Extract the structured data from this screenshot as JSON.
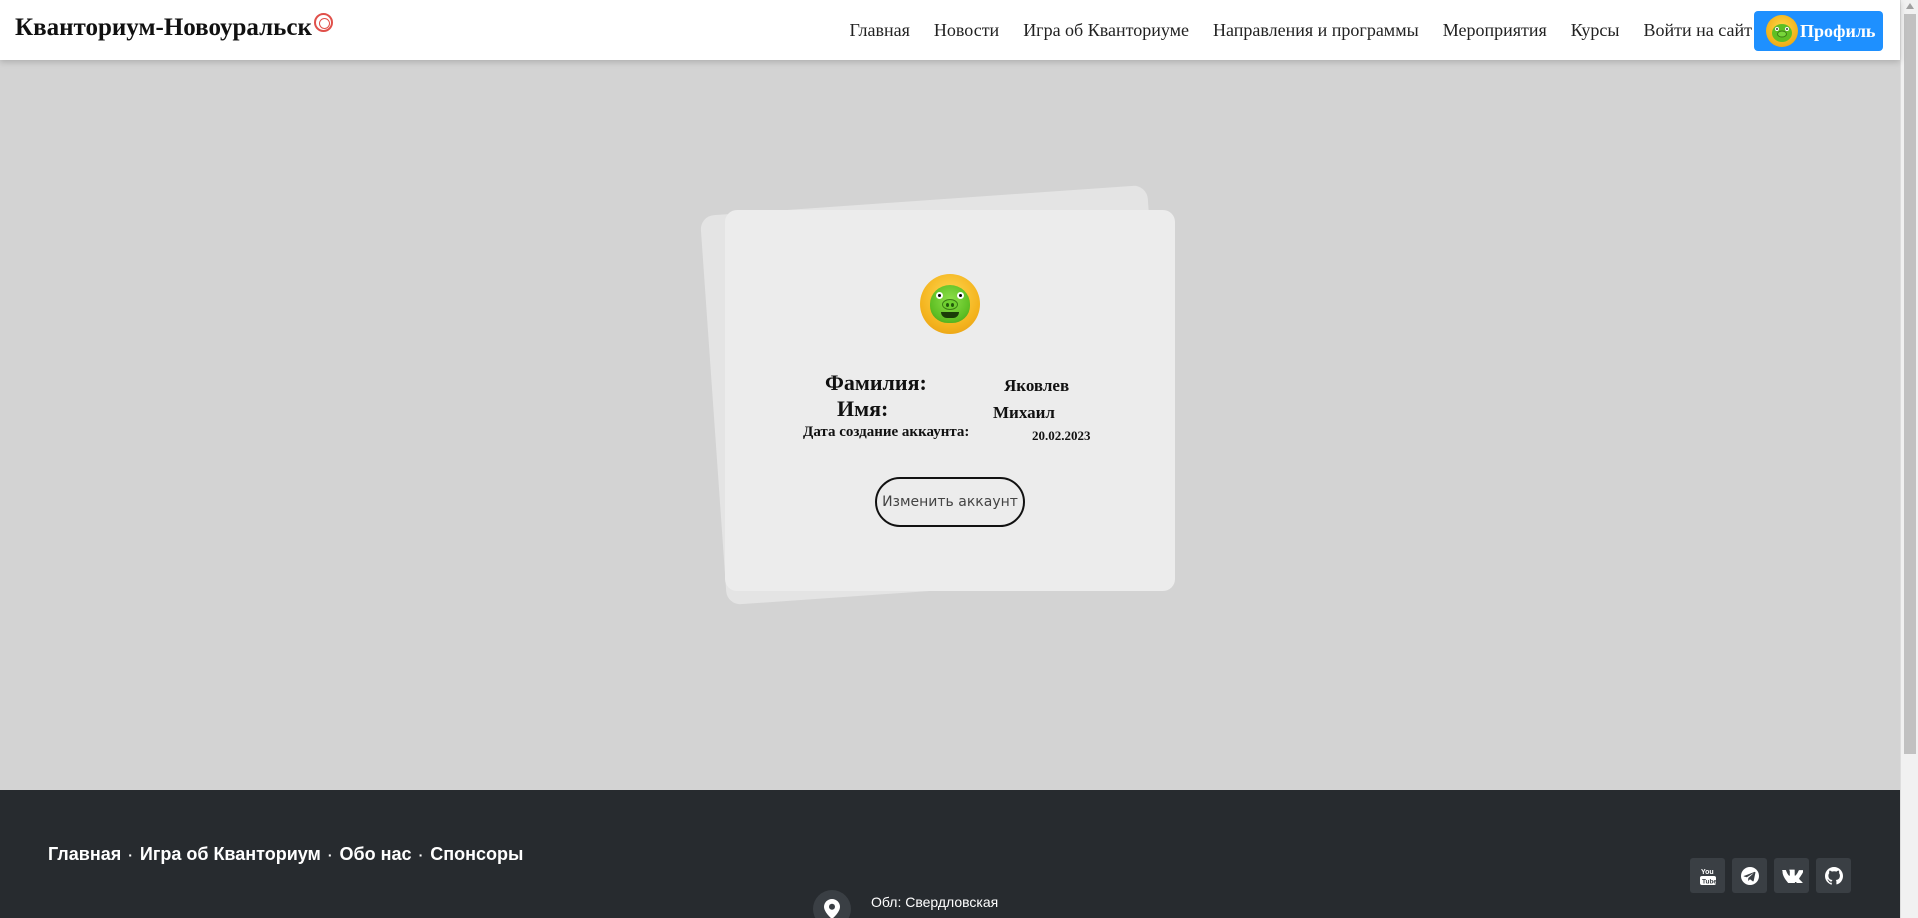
{
  "header": {
    "brand": "Кванториум-Новоуральск",
    "nav": [
      "Главная",
      "Новости",
      "Игра об Кванториуме",
      "Направления и программы",
      "Мероприятия",
      "Курсы",
      "Войти на сайт"
    ],
    "profile_label": "Профиль"
  },
  "profile": {
    "surname_label": "Фамилия:",
    "surname": "Яковлев",
    "name_label": "Имя:",
    "name": "Михаил",
    "created_label": "Дата создание аккаунта:",
    "created": "20.02.2023",
    "edit_button": "Изменить аккаунт"
  },
  "footer": {
    "links": [
      "Главная",
      "Игра об Кванториум",
      "Обо нас",
      "Спонсоры"
    ],
    "separator": "·",
    "address": "Обл: Свердловская",
    "socials": [
      "youtube-icon",
      "telegram-icon",
      "vk-icon",
      "github-icon"
    ]
  },
  "colors": {
    "accent": "#1e90ff",
    "footer_bg": "#272b2f",
    "page_bg": "#d3d3d3"
  }
}
